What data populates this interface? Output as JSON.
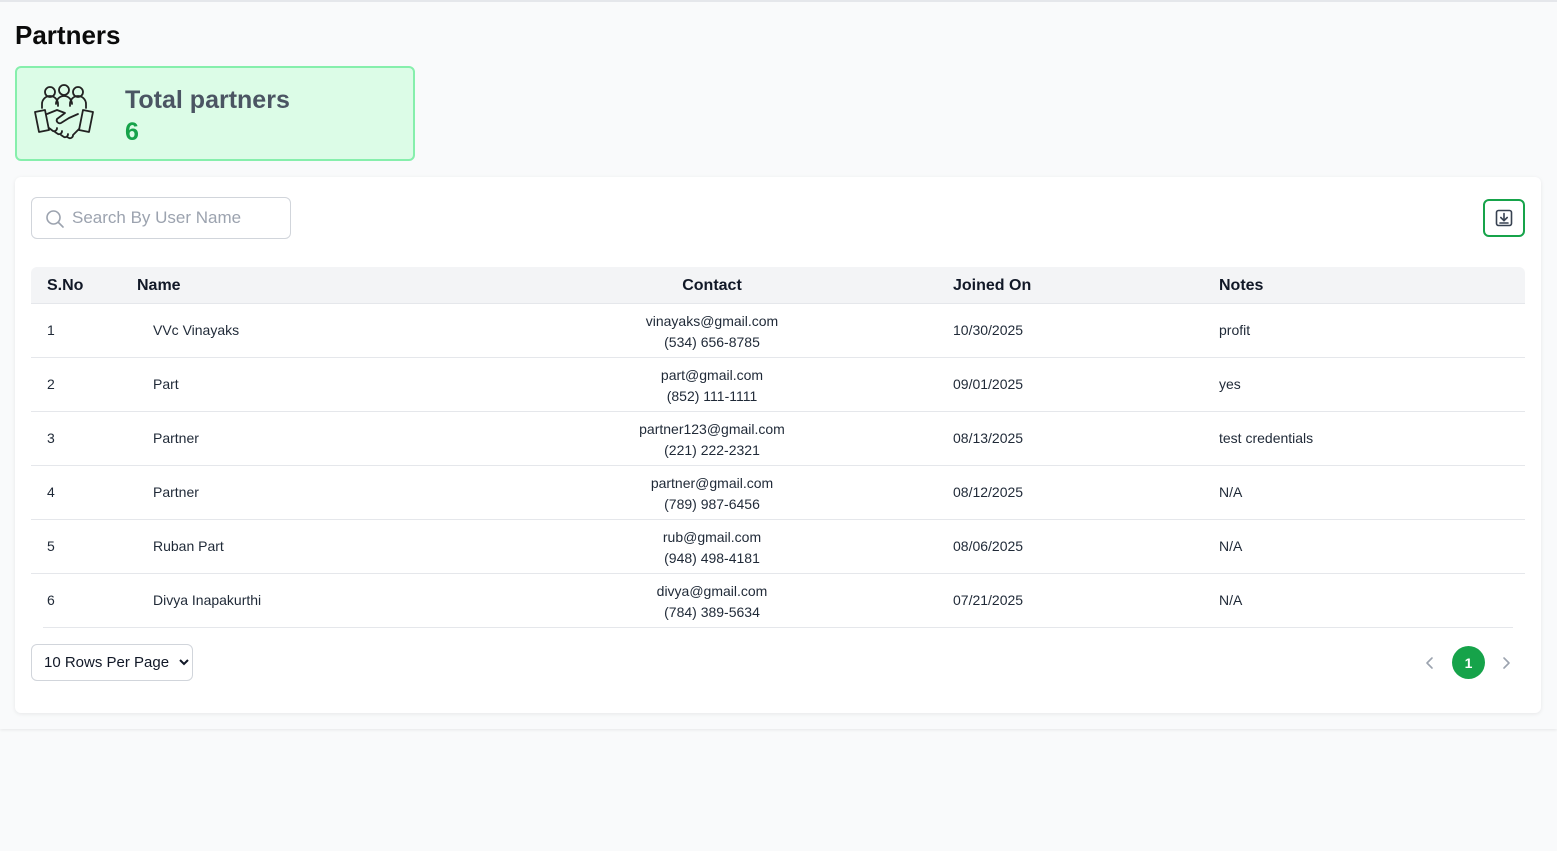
{
  "page": {
    "title": "Partners"
  },
  "stat": {
    "label": "Total partners",
    "value": "6",
    "icon": "partners-handshake-icon"
  },
  "search": {
    "placeholder": "Search By User Name",
    "value": ""
  },
  "toolbar": {
    "download_icon": "download-icon"
  },
  "table": {
    "headers": {
      "sno": "S.No",
      "name": "Name",
      "contact": "Contact",
      "joined": "Joined On",
      "notes": "Notes"
    },
    "rows": [
      {
        "sno": "1",
        "name": "VVc Vinayaks",
        "email": "vinayaks@gmail.com",
        "phone": "(534) 656-8785",
        "joined": "10/30/2025",
        "notes": "profit"
      },
      {
        "sno": "2",
        "name": "Part",
        "email": "part@gmail.com",
        "phone": "(852) 111-1111",
        "joined": "09/01/2025",
        "notes": "yes"
      },
      {
        "sno": "3",
        "name": "Partner",
        "email": "partner123@gmail.com",
        "phone": "(221) 222-2321",
        "joined": "08/13/2025",
        "notes": "test credentials"
      },
      {
        "sno": "4",
        "name": "Partner",
        "email": "partner@gmail.com",
        "phone": "(789) 987-6456",
        "joined": "08/12/2025",
        "notes": "N/A"
      },
      {
        "sno": "5",
        "name": "Ruban Part",
        "email": "rub@gmail.com",
        "phone": "(948) 498-4181",
        "joined": "08/06/2025",
        "notes": "N/A"
      },
      {
        "sno": "6",
        "name": "Divya Inapakurthi",
        "email": "divya@gmail.com",
        "phone": "(784) 389-5634",
        "joined": "07/21/2025",
        "notes": "N/A"
      }
    ]
  },
  "pagination": {
    "rows_per_page": "10 Rows Per Page",
    "current_page": "1"
  },
  "colors": {
    "accent": "#16a34a",
    "card_bg": "#dcfce7",
    "card_border": "#86efac"
  }
}
